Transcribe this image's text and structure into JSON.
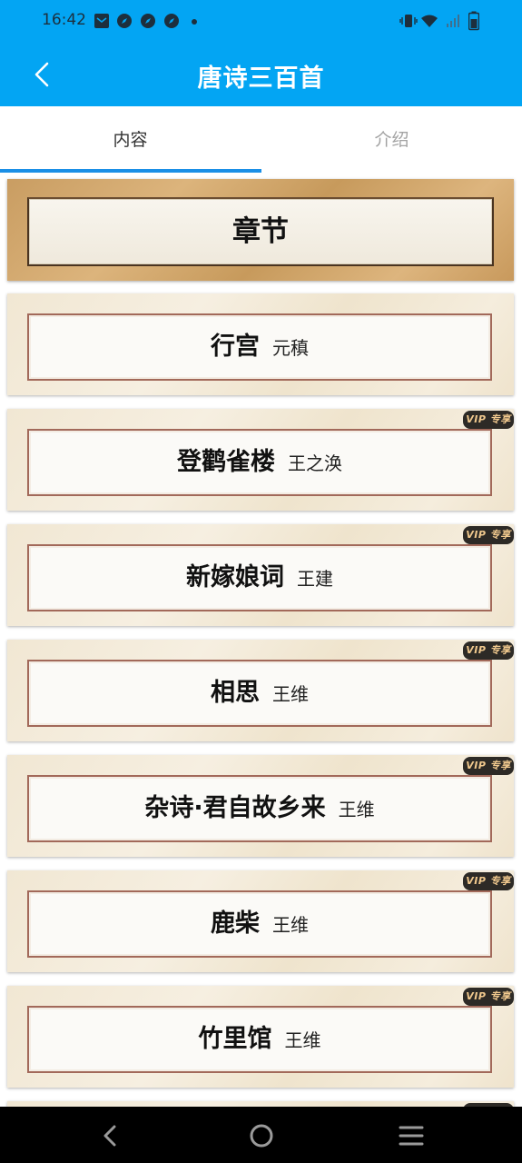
{
  "status_bar": {
    "time": "16:42",
    "left_icons": [
      "mail-icon",
      "compass-icon",
      "compass-icon",
      "compass-icon",
      "dot-icon"
    ],
    "right_icons": [
      "vibrate-icon",
      "wifi-icon",
      "signal-icon",
      "battery-icon"
    ]
  },
  "app_bar": {
    "back_icon": "back-arrow-icon",
    "title": "唐诗三百首",
    "color": "#03a5f3"
  },
  "tabs": [
    {
      "label": "内容",
      "selected": true
    },
    {
      "label": "介绍",
      "selected": false
    }
  ],
  "section_header": "章节",
  "vip_label": "VIP 专享",
  "chapters": [
    {
      "title": "行宫",
      "author": "元稹",
      "vip": false
    },
    {
      "title": "登鹳雀楼",
      "author": "王之涣",
      "vip": true
    },
    {
      "title": "新嫁娘词",
      "author": "王建",
      "vip": true
    },
    {
      "title": "相思",
      "author": "王维",
      "vip": true
    },
    {
      "title": "杂诗·君自故乡来",
      "author": "王维",
      "vip": true
    },
    {
      "title": "鹿柴",
      "author": "王维",
      "vip": true
    },
    {
      "title": "竹里馆",
      "author": "王维",
      "vip": true
    }
  ],
  "nav_bar": {
    "buttons": [
      "back-icon",
      "home-icon",
      "menu-icon"
    ]
  }
}
